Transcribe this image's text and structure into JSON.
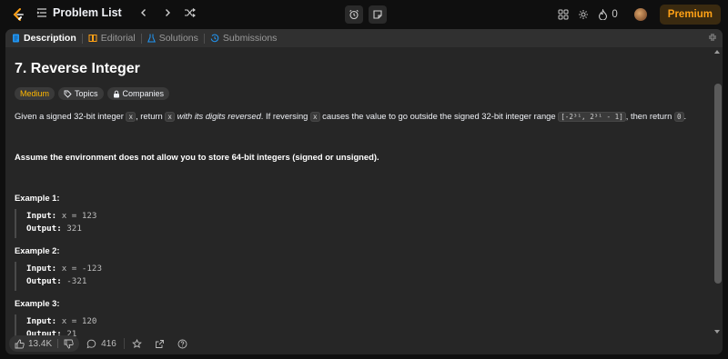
{
  "nav": {
    "problem_list": "Problem List",
    "streak_count": "0",
    "premium": "Premium"
  },
  "tabs": [
    {
      "label": "Description"
    },
    {
      "label": "Editorial"
    },
    {
      "label": "Solutions"
    },
    {
      "label": "Submissions"
    }
  ],
  "problem": {
    "title": "7. Reverse Integer",
    "difficulty": "Medium",
    "topics": "Topics",
    "companies": "Companies",
    "desc": {
      "p1": "Given a signed 32-bit integer ",
      "x": "x",
      "p2": ", return ",
      "p3": " ",
      "italic": "with its digits reversed",
      "p4": ". If reversing ",
      "p5": " causes the value to go outside the signed 32-bit integer range ",
      "range": "[-2³¹, 2³¹ - 1]",
      "p6": ", then return ",
      "zero": "0",
      "p7": "."
    },
    "note": "Assume the environment does not allow you to store 64-bit integers (signed or unsigned).",
    "examples": [
      {
        "label": "Example 1:",
        "input_label": "Input:",
        "input": " x = 123",
        "output_label": "Output:",
        "output": " 321"
      },
      {
        "label": "Example 2:",
        "input_label": "Input:",
        "input": " x = -123",
        "output_label": "Output:",
        "output": " -321"
      },
      {
        "label": "Example 3:",
        "input_label": "Input:",
        "input": " x = 120",
        "output_label": "Output:",
        "output": " 21"
      }
    ]
  },
  "footer": {
    "likes": "13.4K",
    "comments": "416"
  },
  "colors": {
    "accent": "#ffa116",
    "medium": "#ffb800",
    "description_tab_icon": "#2196f3",
    "editorial_icon": "#ffa116",
    "solutions_icon": "#2196f3",
    "submissions_icon": "#2196f3"
  }
}
